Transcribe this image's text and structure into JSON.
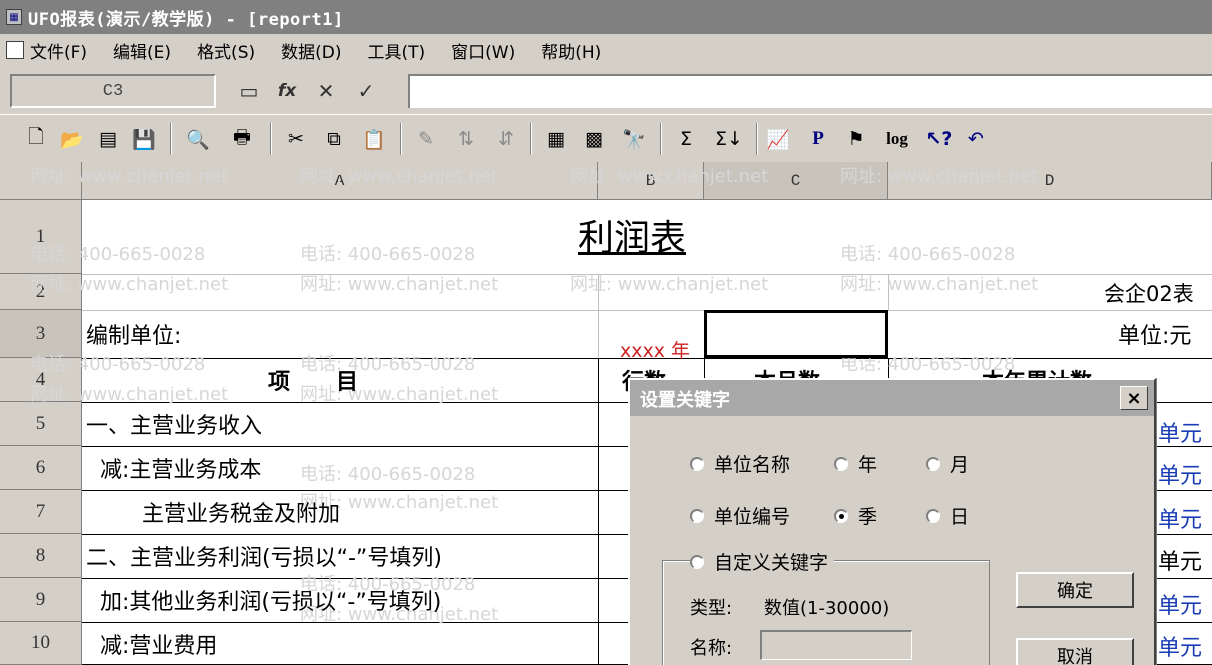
{
  "window": {
    "title": "UFO报表(演示/教学版) - [report1]"
  },
  "menu": [
    {
      "label": "文件(F)"
    },
    {
      "label": "编辑(E)"
    },
    {
      "label": "格式(S)"
    },
    {
      "label": "数据(D)"
    },
    {
      "label": "工具(T)"
    },
    {
      "label": "窗口(W)"
    },
    {
      "label": "帮助(H)"
    }
  ],
  "formula_bar": {
    "cell_ref": "C3",
    "fx": "fx",
    "cancel": "✕",
    "confirm": "✓",
    "value": ""
  },
  "toolbar": [
    {
      "name": "new-icon",
      "glyph": "🗋"
    },
    {
      "name": "open-icon",
      "glyph": "📂"
    },
    {
      "name": "document-icon",
      "glyph": "▤"
    },
    {
      "name": "save-icon",
      "glyph": "💾"
    },
    {
      "name": "print-preview-icon",
      "glyph": "🔍"
    },
    {
      "name": "print-icon",
      "glyph": "🖶"
    },
    {
      "name": "cut-icon",
      "glyph": "✂"
    },
    {
      "name": "copy-icon",
      "glyph": "⧉"
    },
    {
      "name": "paste-icon",
      "glyph": "📋"
    },
    {
      "name": "format-painter-icon",
      "glyph": "✎"
    },
    {
      "name": "sort-asc-icon",
      "glyph": "⇅"
    },
    {
      "name": "sort-desc-icon",
      "glyph": "⇵"
    },
    {
      "name": "table-icon",
      "glyph": "▦"
    },
    {
      "name": "grid-icon",
      "glyph": "▩"
    },
    {
      "name": "find-icon",
      "glyph": "🔭"
    },
    {
      "name": "sum-icon",
      "glyph": "Σ"
    },
    {
      "name": "sum-down-icon",
      "glyph": "Σ↓"
    },
    {
      "name": "chart-icon",
      "glyph": "📈"
    },
    {
      "name": "p-icon",
      "glyph": "P"
    },
    {
      "name": "flag-icon",
      "glyph": "⚑"
    },
    {
      "name": "log-icon",
      "glyph": "log"
    },
    {
      "name": "help-pointer-icon",
      "glyph": "↖?"
    },
    {
      "name": "undo-icon",
      "glyph": "↶"
    }
  ],
  "columns": [
    "A",
    "B",
    "C",
    "D"
  ],
  "rows": [
    "1",
    "2",
    "3",
    "4",
    "5",
    "6",
    "7",
    "8",
    "9",
    "10"
  ],
  "sheet": {
    "title": "利润表",
    "form_no": "会企02表",
    "unit_label": "编制单位:",
    "keyword_year": "xxxx 年",
    "currency": "单位:元",
    "hdr_item": "项      目",
    "hdr_line": "行数",
    "hdr_month": "本月数",
    "hdr_ytd": "本年累计数",
    "items": [
      "一、主营业务收入",
      "  减:主营业务成本",
      "        主营业务税金及附加",
      "二、主营业务利润(亏损以“-”号填列)",
      "  加:其他业务利润(亏损以“-”号填列)",
      "  减:营业费用"
    ],
    "d_col_values": [
      "单元",
      "单元",
      "单元",
      "单元",
      "单元",
      "单元"
    ]
  },
  "watermark": {
    "phone": "电话: 400-665-0028",
    "site": "网址: www.chanjet.net"
  },
  "dialog": {
    "title": "设置关键字",
    "close": "×",
    "opt_unit_name": "单位名称",
    "opt_year": "年",
    "opt_month": "月",
    "opt_unit_code": "单位编号",
    "opt_quarter": "季",
    "opt_day": "日",
    "opt_custom": "自定义关键字",
    "type_label": "类型:",
    "type_value": "数值(1-30000)",
    "name_label": "名称:",
    "ok": "确定",
    "cancel": "取消",
    "selected": "opt_quarter"
  }
}
